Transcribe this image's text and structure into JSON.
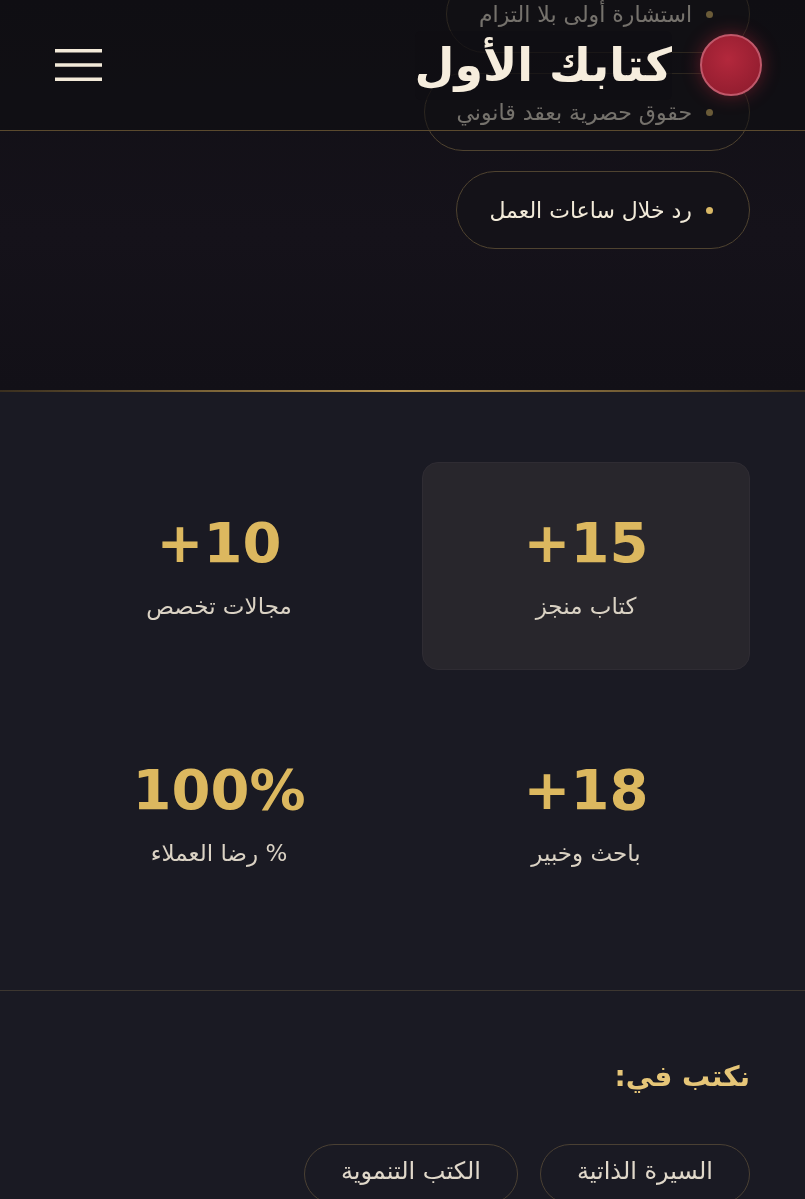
{
  "header": {
    "title": "كتابك الأول"
  },
  "features": [
    {
      "text": "استشارة أولى بلا التزام"
    },
    {
      "text": "حقوق حصرية بعقد قانوني"
    },
    {
      "text": "رد خلال ساعات العمل"
    }
  ],
  "stats": [
    {
      "value": "+15",
      "label": "كتاب منجز",
      "highlighted": true
    },
    {
      "value": "+10",
      "label": "مجالات تخصص",
      "highlighted": false
    },
    {
      "value": "+18",
      "label": "باحث وخبير",
      "highlighted": false
    },
    {
      "value": "100%",
      "label": "% رضا العملاء",
      "highlighted": false
    }
  ],
  "topics": {
    "heading": "نكتب في:",
    "items": [
      "السيرة الذاتية",
      "الكتب التنموية"
    ]
  }
}
